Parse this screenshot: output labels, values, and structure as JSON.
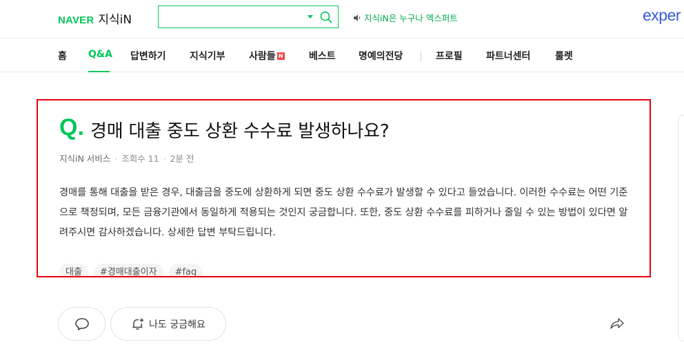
{
  "header": {
    "logo_naver": "NAVER",
    "logo_service": "지식iN",
    "search": {
      "value": "",
      "placeholder": ""
    },
    "notice": "지식iN은 누구나 엑스퍼트",
    "expert_logo": "exper"
  },
  "nav": {
    "items": [
      {
        "label": "홈"
      },
      {
        "label": "Q&A",
        "active": true
      },
      {
        "label": "답변하기"
      },
      {
        "label": "지식기부"
      },
      {
        "label": "사람들",
        "badge": "N"
      },
      {
        "label": "베스트"
      },
      {
        "label": "명예의전당"
      },
      {
        "label": "프로필"
      },
      {
        "label": "파트너센터"
      },
      {
        "label": "룰렛"
      }
    ]
  },
  "question": {
    "mark": "Q.",
    "title": "경매 대출 중도 상환 수수료 발생하나요?",
    "author": "지식iN 서비스",
    "views_label": "조회수 11",
    "time": "2분 전",
    "body": "경매를 통해 대출을 받은 경우, 대출금을 중도에 상환하게 되면 중도 상환 수수료가 발생할 수 있다고 들었습니다. 이러한 수수료는 어떤 기준으로 책정되며, 모든 금융기관에서 동일하게 적용되는 것인지 궁금합니다. 또한, 중도 상환 수수료를 피하거나 줄일 수 있는 방법이 있다면 알려주시면 감사하겠습니다. 상세한 답변 부탁드립니다.",
    "tags": [
      "대출",
      "#경매대출이자",
      "#faq"
    ]
  },
  "actions": {
    "wonder_label": "나도 궁금해요"
  },
  "colors": {
    "brand_green": "#03c75a",
    "highlight_red": "#e8000b",
    "expert_blue": "#3a5bd9"
  }
}
